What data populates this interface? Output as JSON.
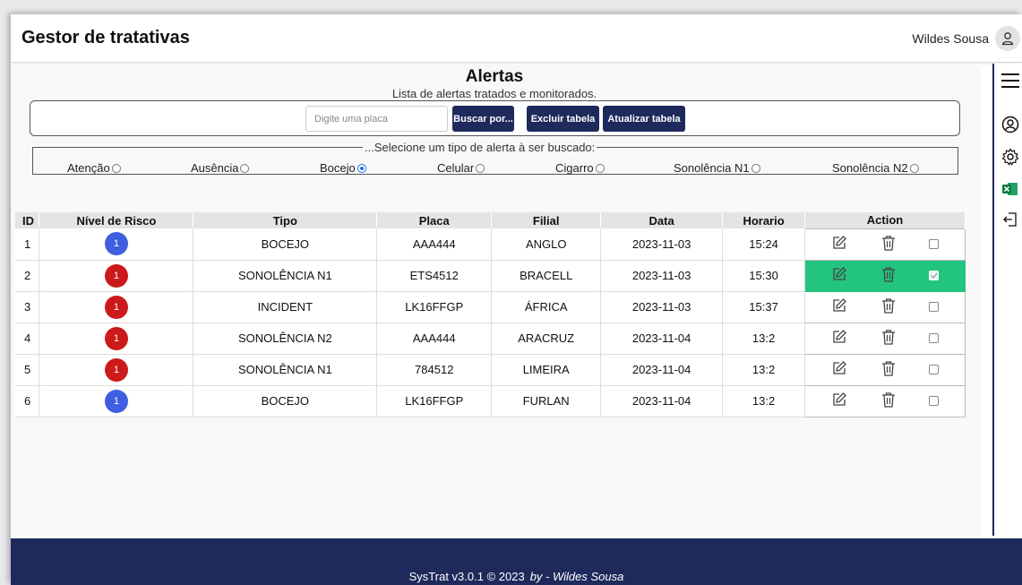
{
  "header": {
    "app_title": "Gestor de tratativas",
    "user_name": "Wildes Sousa"
  },
  "page": {
    "heading": "Alertas",
    "subtitle": "Lista de alertas tratados e monitorados."
  },
  "search": {
    "placeholder": "Digite uma placa",
    "value": "",
    "buttons": {
      "search": "Buscar por...",
      "delete": "Excluir tabela",
      "refresh": "Atualizar tabela"
    }
  },
  "alert_types": {
    "legend": "...Selecione um tipo de alerta à ser buscado:",
    "selected": "Bocejo",
    "options": [
      "Atenção",
      "Ausência",
      "Bocejo",
      "Celular",
      "Cigarro",
      "Sonolência N1",
      "Sonolência N2"
    ]
  },
  "table": {
    "columns": [
      "ID",
      "Nível de Risco",
      "Tipo",
      "Placa",
      "Filial",
      "Data",
      "Horario",
      "Action"
    ],
    "rows": [
      {
        "id": "1",
        "risk": "1",
        "risk_color": "#3f5ee0",
        "tipo": "BOCEJO",
        "placa": "AAA444",
        "filial": "ANGLO",
        "data": "2023-11-03",
        "horario": "15:24",
        "checked": false
      },
      {
        "id": "2",
        "risk": "1",
        "risk_color": "#cc1a1a",
        "tipo": "SONOLÊNCIA N1",
        "placa": "ETS4512",
        "filial": "BRACELL",
        "data": "2023-11-03",
        "horario": "15:30",
        "checked": true
      },
      {
        "id": "3",
        "risk": "1",
        "risk_color": "#cc1a1a",
        "tipo": "INCIDENT",
        "placa": "LK16FFGP",
        "filial": "ÁFRICA",
        "data": "2023-11-03",
        "horario": "15:37",
        "checked": false
      },
      {
        "id": "4",
        "risk": "1",
        "risk_color": "#cc1a1a",
        "tipo": "SONOLÊNCIA N2",
        "placa": "AAA444",
        "filial": "ARACRUZ",
        "data": "2023-11-04",
        "horario": "13:2",
        "checked": false
      },
      {
        "id": "5",
        "risk": "1",
        "risk_color": "#cc1a1a",
        "tipo": "SONOLÊNCIA N1",
        "placa": "784512",
        "filial": "LIMEIRA",
        "data": "2023-11-04",
        "horario": "13:2",
        "checked": false
      },
      {
        "id": "6",
        "risk": "1",
        "risk_color": "#3f5ee0",
        "tipo": "BOCEJO",
        "placa": "LK16FFGP",
        "filial": "FURLAN",
        "data": "2023-11-04",
        "horario": "13:2",
        "checked": false
      }
    ],
    "action_icons": [
      "edit-icon",
      "trash-icon",
      "checkbox"
    ]
  },
  "sidebar": {
    "icons": [
      "menu-icon",
      "user-circle-icon",
      "gear-icon",
      "excel-icon",
      "logout-icon"
    ]
  },
  "footer": {
    "text": "SysTrat v3.0.1 © 2023",
    "author": "by - Wildes Sousa"
  },
  "colors": {
    "navy": "#1f2a5c",
    "selected_row": "#22c47e",
    "risk_blue": "#3f5ee0",
    "risk_red": "#cc1a1a"
  }
}
